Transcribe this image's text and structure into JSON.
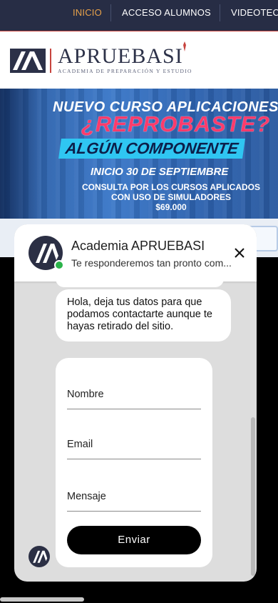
{
  "nav": {
    "items": [
      {
        "label": "INICIO",
        "active": true
      },
      {
        "label": "ACCESO ALUMNOS"
      },
      {
        "label": "VIDEOTECA"
      }
    ]
  },
  "brand": {
    "name": "APRUEBASI",
    "tagline": "ACADEMIA DE PREPARACIÓN Y ESTUDIO"
  },
  "banner": {
    "line1": "NUEVO CURSO APLICACIONES",
    "line2": "¿REPROBASTE?",
    "line3": "ALGÚN COMPONENTE",
    "line4": "INICIO 30 DE SEPTIEMBRE",
    "line5a": "CONSULTA POR LOS CURSOS APLICADOS",
    "line5b": "CON USO DE SIMULADORES",
    "price": "$69.000"
  },
  "chat": {
    "title": "Academia APRUEBASI",
    "subtitle": "Te responderemos tan pronto com...",
    "message": "Hola, deja tus datos para que podamos contactarte aunque te hayas retirado del sitio.",
    "fields": {
      "name": "Nombre",
      "email": "Email",
      "message": "Mensaje"
    },
    "send_label": "Enviar"
  },
  "colors": {
    "nav_bg": "#272d45",
    "nav_active": "#e8a24a",
    "accent_red": "#c7443e",
    "online": "#2bb34a"
  }
}
